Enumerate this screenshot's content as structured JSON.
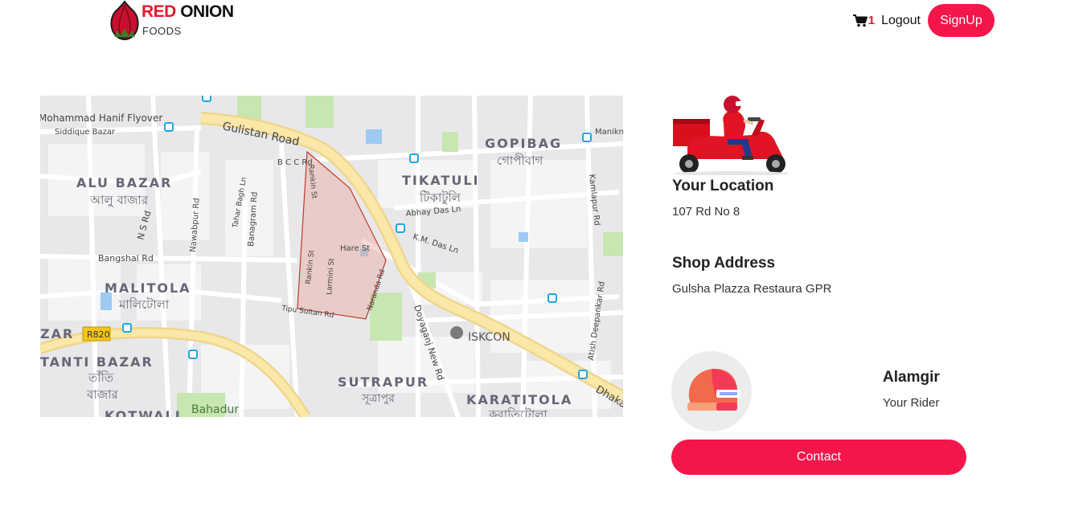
{
  "header": {
    "brand_primary": "RED",
    "brand_secondary": "ONION",
    "brand_sub": "FOODS",
    "cart_count": "1",
    "logout_label": "Logout",
    "signup_label": "SignUp"
  },
  "map": {
    "labels": {
      "flyover": "Mohammad Hanif Flyover",
      "siddique": "Siddique Bazar",
      "gulistan": "Gulistan Road",
      "bcc": "B C C Rd",
      "gopibag": "GOPIBAG",
      "gopibag_bn": "গোপীবাগ",
      "manikn": "Manikn",
      "alu_bazar": "ALU BAZAR",
      "alu_bazar_bn": "আলু বাজার",
      "tikatuli": "TIKATULI",
      "tikatuli_bn": "টিকাটুলি",
      "abhay": "Abhay Das Ln",
      "km_das": "K.M. Das Ln",
      "ns_rd": "N S Rd",
      "nawabpur": "Nawabpur Rd",
      "tahar_bagh": "Tahar Bagh Ln",
      "banagram": "Banagram Rd",
      "rankin_top": "Rankin St",
      "rankin": "Rankin St",
      "larmini": "Larmini St",
      "hare": "Hare St",
      "naranda": "Naranda Rd",
      "tipu": "Tipu Sultan Rd",
      "bangshal": "Bangshal Rd",
      "malitola": "MALITOLA",
      "malitola_bn": "মালিটোলা",
      "kamlapur": "Kamlapur Rd",
      "atish": "Atish Deepankar Rd",
      "doyaganj": "Doyaganj New Rd",
      "iskcon": "ISKCON",
      "zar": "ZAR",
      "r820": "R820",
      "tanti": "TANTI BAZAR",
      "tanti_bn1": "তাঁতি",
      "tanti_bn2": "বাজার",
      "sutrapur": "SUTRAPUR",
      "sutrapur_bn": "সূত্রাপুর",
      "karatitola": "KARATITOLA",
      "karatitola_bn": "করাতিটোলা",
      "dhaka": "Dhaka",
      "kotwali": "KOTWALI",
      "bahadur": "Bahadur"
    }
  },
  "delivery": {
    "location_title": "Your Location",
    "location_value": "107 Rd No 8",
    "shop_title": "Shop Address",
    "shop_value": "Gulsha Plazza Restaura GPR"
  },
  "rider": {
    "name": "Alamgir",
    "role": "Your Rider",
    "contact_label": "Contact"
  },
  "colors": {
    "accent": "#f4164b",
    "brand_red": "#e21b2c"
  }
}
